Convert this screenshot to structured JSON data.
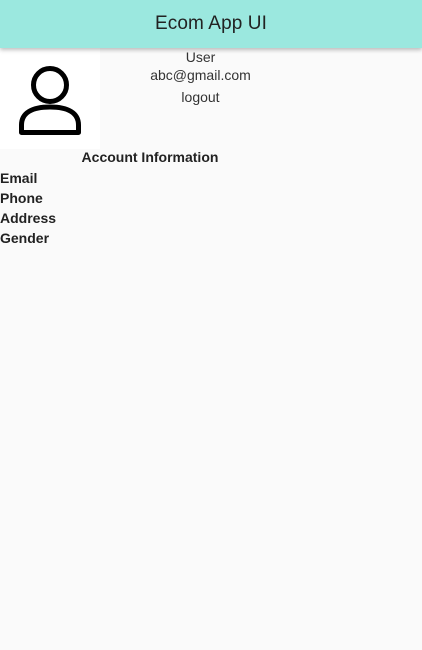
{
  "app_bar": {
    "title": "Ecom App UI",
    "background_color": "#9be8df"
  },
  "profile": {
    "avatar_icon": "person-icon",
    "name": "User",
    "email": "abc@gmail.com",
    "logout_label": "logout"
  },
  "account": {
    "title": "Account Information",
    "items": [
      {
        "label": "Email"
      },
      {
        "label": "Phone"
      },
      {
        "label": "Address"
      },
      {
        "label": "Gender"
      }
    ]
  }
}
